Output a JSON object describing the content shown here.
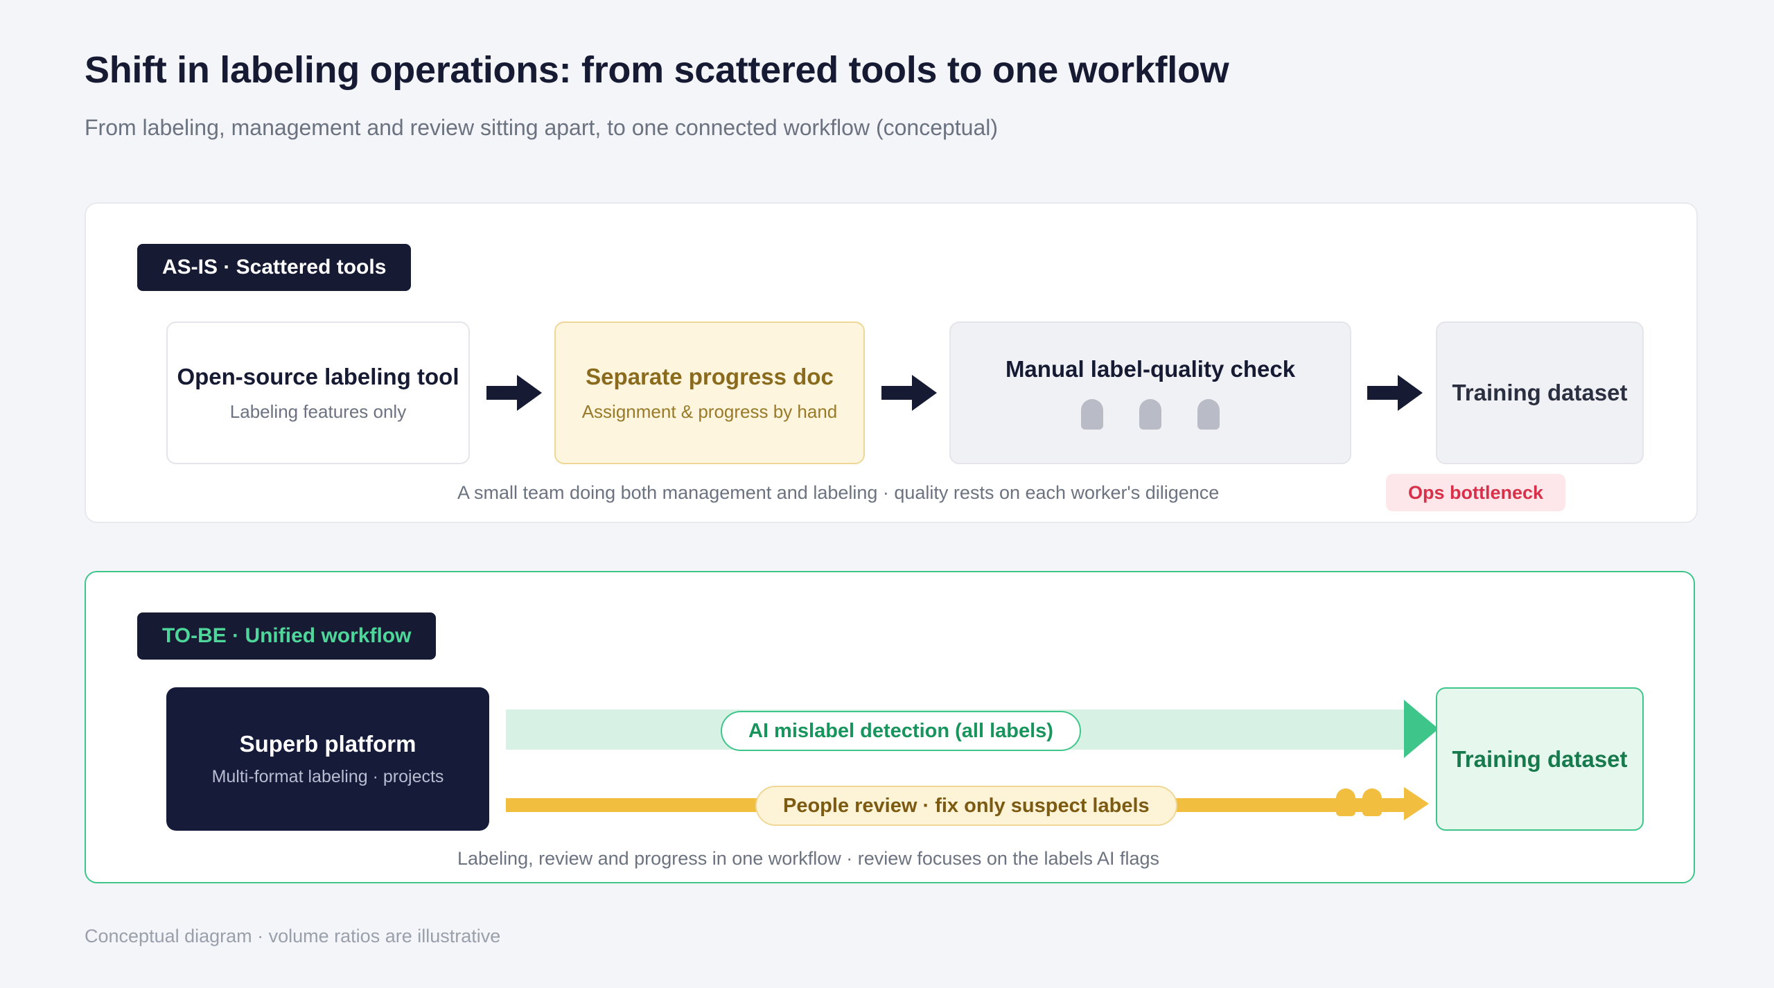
{
  "header": {
    "title": "Shift in labeling operations: from scattered tools to one workflow",
    "subtitle": "From labeling, management and review sitting apart, to one connected workflow (conceptual)"
  },
  "as_is": {
    "tag": "AS-IS · Scattered tools",
    "steps": [
      {
        "title": "Open-source labeling tool",
        "subtitle": "Labeling features only"
      },
      {
        "title": "Separate progress doc",
        "subtitle": "Assignment & progress by hand"
      },
      {
        "title": "Manual label-quality check"
      },
      {
        "title": "Training dataset"
      }
    ],
    "note": "A small team doing both management and labeling · quality rests on each worker's diligence",
    "badge": "Ops bottleneck"
  },
  "to_be": {
    "tag": "TO-BE · Unified workflow",
    "platform": {
      "title": "Superb platform",
      "subtitle": "Multi-format labeling · projects"
    },
    "flow_ai": "AI mislabel detection (all labels)",
    "flow_people": "People review · fix only suspect labels",
    "output": "Training dataset",
    "note": "Labeling, review and progress in one workflow · review focuses on the labels AI flags"
  },
  "footnote": "Conceptual diagram · volume ratios are illustrative",
  "colors": {
    "navy": "#161b33",
    "green": "#3ec68a",
    "amber": "#f2be40",
    "red": "#d9304a"
  }
}
